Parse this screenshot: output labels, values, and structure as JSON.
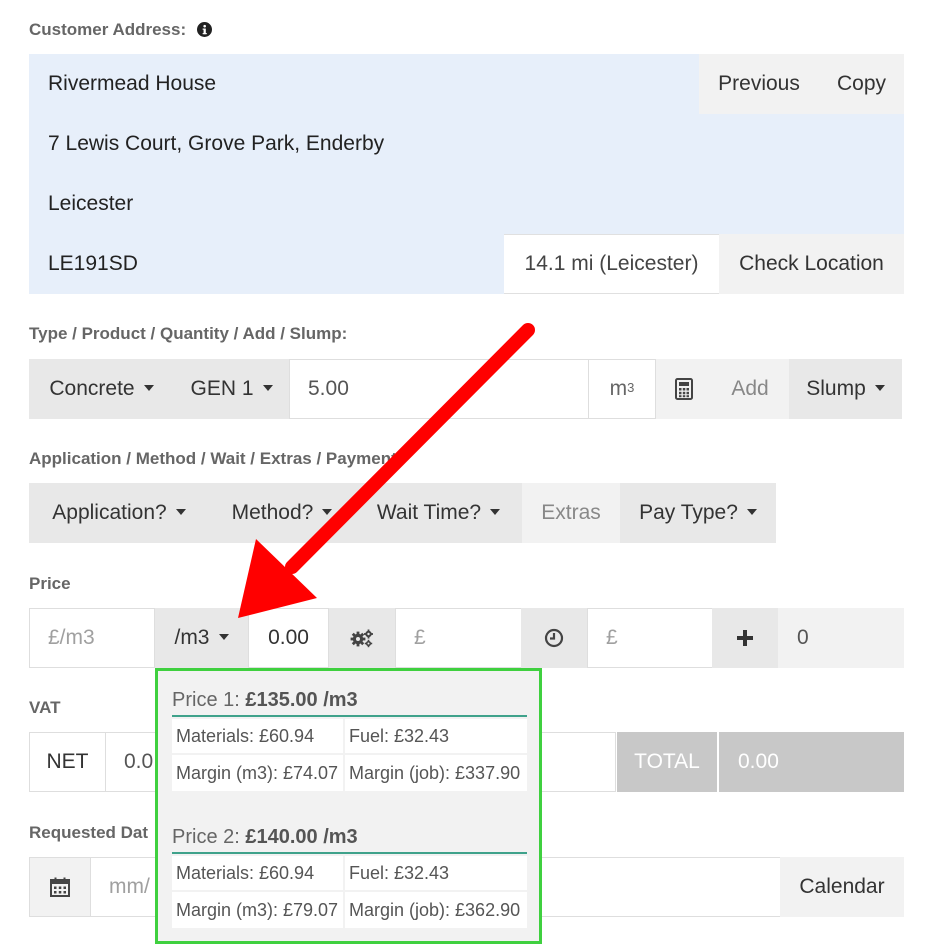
{
  "address": {
    "label": "Customer Address:",
    "line1": "Rivermead House",
    "line2": "7 Lewis Court, Grove Park, Enderby",
    "line3": "Leicester",
    "postcode": "LE191SD",
    "previous_label": "Previous",
    "copy_label": "Copy",
    "distance": "14.1 mi (Leicester)",
    "check_location_label": "Check Location"
  },
  "product": {
    "label": "Type / Product / Quantity / Add / Slump:",
    "type": "Concrete",
    "product": "GEN 1",
    "quantity": "5.00",
    "unit": "m",
    "unit_sup": "3",
    "add_label": "Add",
    "slump_label": "Slump"
  },
  "application": {
    "label": "Application / Method / Wait / Extras / Payment",
    "application": "Application?",
    "method": "Method?",
    "wait_time": "Wait Time?",
    "extras": "Extras",
    "pay_type": "Pay Type?"
  },
  "price": {
    "label": "Price",
    "per_unit_placeholder": "£/m3",
    "unit_select": "/m3",
    "value": "0.00",
    "amount_placeholder": "£",
    "time_placeholder": "£",
    "extra_value": "0"
  },
  "vat": {
    "label": "VAT",
    "net_label": "NET",
    "net_value": "0.0",
    "total_label": "TOTAL",
    "total_value": "0.00"
  },
  "date": {
    "label": "Requested Dat",
    "placeholder": "mm/",
    "calendar_label": "Calendar"
  },
  "popup": {
    "price1": {
      "title_prefix": "Price 1: ",
      "title_value": "£135.00 /m3",
      "materials": "Materials: £60.94",
      "fuel": "Fuel: £32.43",
      "margin_m3": "Margin (m3): £74.07",
      "margin_job": "Margin (job): £337.90"
    },
    "price2": {
      "title_prefix": "Price 2: ",
      "title_value": "£140.00 /m3",
      "materials": "Materials: £60.94",
      "fuel": "Fuel: £32.43",
      "margin_m3": "Margin (m3): £79.07",
      "margin_job": "Margin (job): £362.90"
    }
  },
  "colors": {
    "address_bg": "#e7effa",
    "popup_border": "#3fd03f",
    "arrow": "#ff0000",
    "total_bg": "#c8c8c8"
  }
}
